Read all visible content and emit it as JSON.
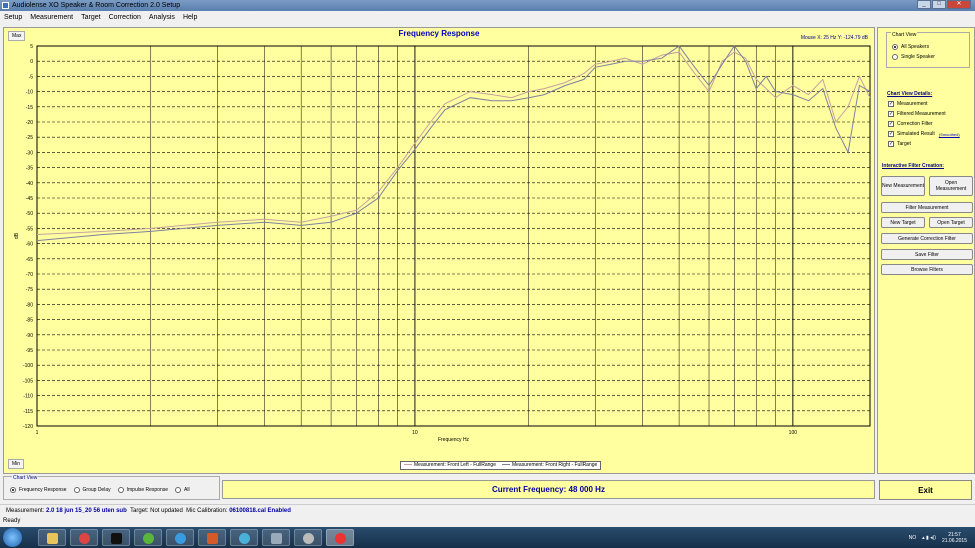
{
  "window": {
    "title": "Audiolense XO Speaker & Room Correction 2.0 Setup"
  },
  "menu": [
    "Setup",
    "Measurement",
    "Target",
    "Correction",
    "Analysis",
    "Help"
  ],
  "chart": {
    "max_label": "Max",
    "min_label": "Min",
    "mouse_info": "Mouse X: 25 Hz   Y: -124.79 dB"
  },
  "chart_data": {
    "type": "line",
    "title": "Frequency Response",
    "xlabel": "Frequency Hz",
    "ylabel": "dB",
    "xscale": "log",
    "xlim": [
      1,
      160
    ],
    "ylim": [
      -120,
      5
    ],
    "x_tick_labels": [
      "1",
      "10",
      "100"
    ],
    "y_ticks": [
      5,
      0,
      -5,
      -10,
      -15,
      -20,
      -25,
      -30,
      -35,
      -40,
      -45,
      -50,
      -55,
      -60,
      -65,
      -70,
      -75,
      -80,
      -85,
      -90,
      -95,
      -100,
      -105,
      -110,
      -115,
      -120
    ],
    "grid": true,
    "legend_position": "bottom-center",
    "series": [
      {
        "name": "Measurement: Front Left - FullRange",
        "color": "#c8a0a0",
        "x": [
          1,
          1.5,
          2,
          3,
          4,
          5,
          6,
          7,
          8,
          9,
          10,
          11,
          12,
          14,
          16,
          18,
          20,
          22,
          25,
          28,
          30,
          33,
          36,
          40,
          45,
          50,
          55,
          60,
          65,
          70,
          75,
          80,
          85,
          90,
          100,
          110,
          120,
          130,
          140,
          150,
          160
        ],
        "y": [
          -57,
          -56,
          -55,
          -53,
          -52,
          -53,
          -51,
          -49,
          -43,
          -35,
          -27,
          -20,
          -14,
          -10,
          -11,
          -12,
          -10,
          -9,
          -7,
          -4,
          -1,
          0,
          1,
          -1,
          2,
          3,
          -4,
          -10,
          0,
          3,
          1,
          -6,
          -9,
          -12,
          -8,
          -11,
          -6,
          -20,
          -15,
          -5,
          -12
        ]
      },
      {
        "name": "Measurement: Front Right - FullRange",
        "color": "#8080a0",
        "x": [
          1,
          1.5,
          2,
          3,
          4,
          5,
          6,
          7,
          8,
          9,
          10,
          11,
          12,
          14,
          16,
          18,
          20,
          22,
          25,
          28,
          30,
          33,
          36,
          40,
          45,
          50,
          55,
          60,
          65,
          70,
          75,
          80,
          85,
          90,
          100,
          110,
          120,
          130,
          140,
          150,
          160
        ],
        "y": [
          -59,
          -57,
          -56,
          -54,
          -53,
          -54,
          -53,
          -50,
          -45,
          -36,
          -29,
          -22,
          -16,
          -12,
          -13,
          -13,
          -12,
          -11,
          -8,
          -6,
          -2,
          -1,
          0,
          0,
          1,
          5,
          -2,
          -8,
          -1,
          5,
          0,
          -9,
          -5,
          -10,
          -11,
          -13,
          -9,
          -22,
          -30,
          -8,
          -10
        ]
      }
    ]
  },
  "right_panel": {
    "chart_view_title": "Chart View",
    "radio_all": "All Speakers",
    "radio_single": "Single Speaker",
    "details_title": "Chart View Details:",
    "checks": [
      "Measurement",
      "Filtered Measurement",
      "Correction Filter",
      "Simulated Result",
      "Target"
    ],
    "smoothed_link": "(Smoothed)",
    "filter_creation_title": "Interactive Filter Creation:",
    "buttons": {
      "new_measurement": "New Measurement",
      "open_measurement": "Open Measurement",
      "filter_measurement": "Filter Measurement",
      "new_target": "New Target",
      "open_target": "Open Target",
      "generate_filter": "Generate Correction Filter",
      "save_filter": "Save Filter",
      "browse_filters": "Browse Filters"
    }
  },
  "bottom": {
    "chart_view_title": "Chart View",
    "options": [
      "Frequency Response",
      "Group Delay",
      "Impulse Response",
      "All"
    ],
    "current_frequency": "Current Frequency: 48 000 Hz",
    "exit": "Exit"
  },
  "measurement_line": {
    "meas_label": "Measurement:",
    "meas_value": "2.0 18 jun 15_20 56 uten sub",
    "target_label": "Target:",
    "target_value": "Not updated",
    "mic_label": "Mic Calibration:",
    "mic_value": "06100818.cal Enabled"
  },
  "status": "Ready",
  "taskbar": {
    "lang": "NO",
    "time": "21:57",
    "date": "21.06.2015"
  }
}
